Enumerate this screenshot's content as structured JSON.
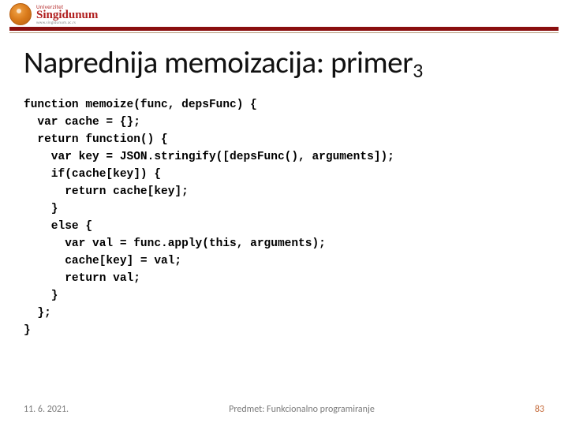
{
  "logo": {
    "topline": "Univerzitet",
    "name": "Singidunum",
    "url": "www.singidunum.ac.rs"
  },
  "title": {
    "main": "Naprednija memoizacija: primer",
    "sub": "3"
  },
  "code": "function memoize(func, depsFunc) {\n  var cache = {};\n  return function() {\n    var key = JSON.stringify([depsFunc(), arguments]);\n    if(cache[key]) {\n      return cache[key];\n    }\n    else {\n      var val = func.apply(this, arguments);\n      cache[key] = val;\n      return val;\n    }\n  };\n}",
  "footer": {
    "date": "11. 6. 2021.",
    "subject": "Predmet: Funkcionalno programiranje",
    "page": "83"
  }
}
